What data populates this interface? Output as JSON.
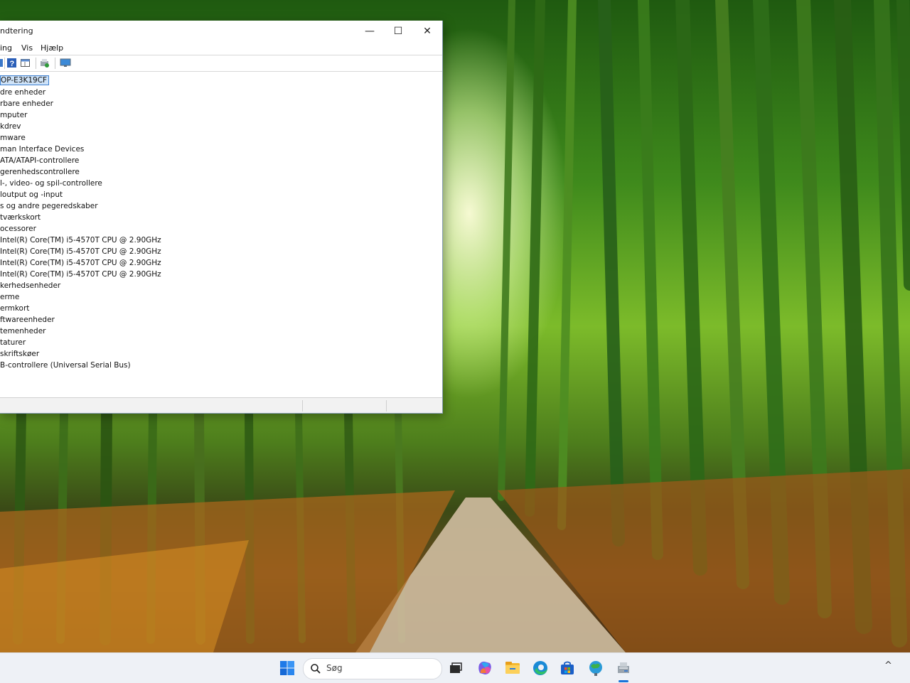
{
  "window": {
    "title": "ndtering",
    "menu": [
      "ing",
      "Vis",
      "Hjælp"
    ],
    "buttons": {
      "minimize": "—",
      "maximize": "☐",
      "close": "✕"
    }
  },
  "toolbar_icons": [
    "back-icon",
    "help-icon",
    "properties-icon",
    "update-driver-icon",
    "monitor-icon"
  ],
  "tree": {
    "items": [
      "OP-E3K19CF",
      "dre enheder",
      "rbare enheder",
      "mputer",
      "kdrev",
      "mware",
      "man Interface Devices",
      " ATA/ATAPI-controllere",
      "gerenhedscontrollere",
      "l-, video- og spil-controllere",
      "loutput og -input",
      "s og andre pegeredskaber",
      "tværkskort",
      "ocessorer",
      " Intel(R) Core(TM) i5-4570T CPU @ 2.90GHz",
      " Intel(R) Core(TM) i5-4570T CPU @ 2.90GHz",
      " Intel(R) Core(TM) i5-4570T CPU @ 2.90GHz",
      " Intel(R) Core(TM) i5-4570T CPU @ 2.90GHz",
      "kerhedsenheder",
      "erme",
      "ermkort",
      "ftwareenheder",
      "temenheder",
      "taturer",
      "skriftskøer",
      "B-controllere (Universal Serial Bus)"
    ]
  },
  "taskbar": {
    "search_placeholder": "Søg",
    "apps": [
      "windows-start-icon",
      "task-view-icon",
      "copilot-icon",
      "file-explorer-icon",
      "edge-icon",
      "microsoft-store-icon",
      "weather-icon",
      "device-manager-icon"
    ],
    "tray": "^"
  },
  "colors": {
    "selection": "#cfe3f8",
    "selection_border": "#3c7fd0",
    "taskbar": "#eef1f6",
    "accent": "#1a73d9"
  }
}
